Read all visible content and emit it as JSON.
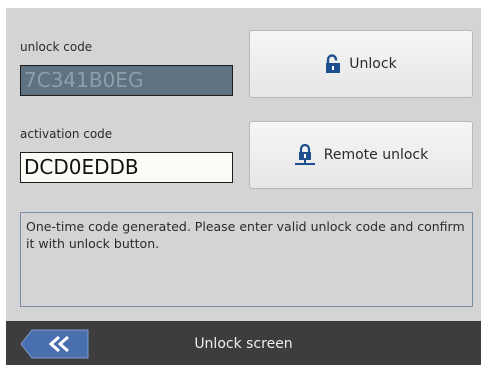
{
  "unlock": {
    "label": "unlock code",
    "code": "7C341B0EG",
    "button_label": "Unlock",
    "button_icon": "unlocked-padlock-icon"
  },
  "activation": {
    "label": "activation code",
    "code": "DCD0EDDB",
    "button_label": "Remote unlock",
    "button_icon": "network-padlock-icon"
  },
  "message": "One-time code generated. Please enter valid unlock code and confirm it with unlock button.",
  "footer": {
    "title": "Unlock screen",
    "back_icon": "double-chevron-left-icon"
  },
  "colors": {
    "background": "#d4d4d4",
    "footer": "#3d3d3d",
    "back_button": "#4a6fae",
    "icon": "#1d4f8e",
    "readonly_field": "#5f7282"
  }
}
